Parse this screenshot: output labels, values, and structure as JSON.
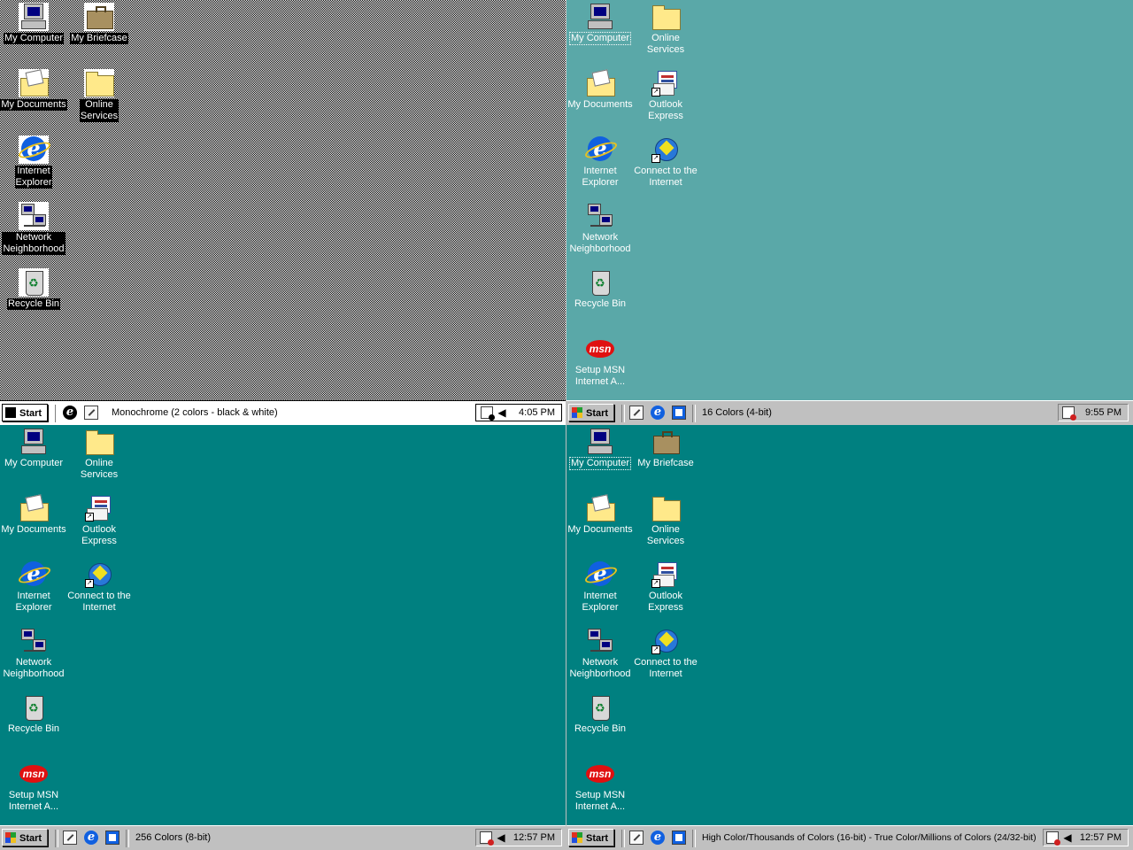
{
  "panels": {
    "mono": {
      "icons": [
        "My Computer",
        "My Briefcase",
        "My Documents",
        "Online Services",
        "Internet Explorer",
        "Network Neighborhood",
        "Recycle Bin"
      ],
      "label_lines": {
        "my_computer": "My Computer",
        "my_briefcase": "My Briefcase",
        "my_documents": "My Documents",
        "online_1": "Online",
        "online_2": "Services",
        "ie_1": "Internet",
        "ie_2": "Explorer",
        "net_1": "Network",
        "net_2": "Neighborhood",
        "recycle": "Recycle Bin"
      },
      "taskbar": {
        "start": "Start",
        "task": "Monochrome (2 colors - black & white)",
        "clock": "4:05 PM"
      }
    },
    "c16": {
      "label_lines": {
        "my_computer": "My Computer",
        "online_1": "Online",
        "online_2": "Services",
        "my_documents": "My Documents",
        "oe_1": "Outlook",
        "oe_2": "Express",
        "ie_1": "Internet",
        "ie_2": "Explorer",
        "conn_1": "Connect to the",
        "conn_2": "Internet",
        "net_1": "Network",
        "net_2": "Neighborhood",
        "recycle": "Recycle Bin",
        "msn_1": "Setup MSN",
        "msn_2": "Internet A..."
      },
      "taskbar": {
        "start": "Start",
        "task": "16 Colors (4-bit)",
        "clock": "9:55 PM"
      }
    },
    "c256": {
      "label_lines": {
        "my_computer": "My Computer",
        "online_1": "Online",
        "online_2": "Services",
        "my_documents": "My Documents",
        "oe_1": "Outlook",
        "oe_2": "Express",
        "ie_1": "Internet",
        "ie_2": "Explorer",
        "conn_1": "Connect to the",
        "conn_2": "Internet",
        "net_1": "Network",
        "net_2": "Neighborhood",
        "recycle": "Recycle Bin",
        "msn_1": "Setup MSN",
        "msn_2": "Internet A..."
      },
      "taskbar": {
        "start": "Start",
        "task": "256 Colors (8-bit)",
        "clock": "12:57 PM"
      }
    },
    "high": {
      "label_lines": {
        "my_computer": "My Computer",
        "my_briefcase": "My Briefcase",
        "my_documents": "My Documents",
        "online_1": "Online",
        "online_2": "Services",
        "ie_1": "Internet",
        "ie_2": "Explorer",
        "oe_1": "Outlook",
        "oe_2": "Express",
        "net_1": "Network",
        "net_2": "Neighborhood",
        "conn_1": "Connect to the",
        "conn_2": "Internet",
        "recycle": "Recycle Bin",
        "msn_1": "Setup MSN",
        "msn_2": "Internet A..."
      },
      "taskbar": {
        "start": "Start",
        "task": "High Color/Thousands of Colors (16-bit) - True Color/Millions of Colors (24/32-bit)",
        "clock": "12:57 PM"
      }
    }
  },
  "icon_glyphs": {
    "ie": "e",
    "msn": "msn",
    "shortcut": "↗",
    "volume": "◀"
  },
  "colors": {
    "teal_16": "#5aa8a8",
    "teal": "#008080",
    "taskbar_gray": "#c0c0c0"
  }
}
